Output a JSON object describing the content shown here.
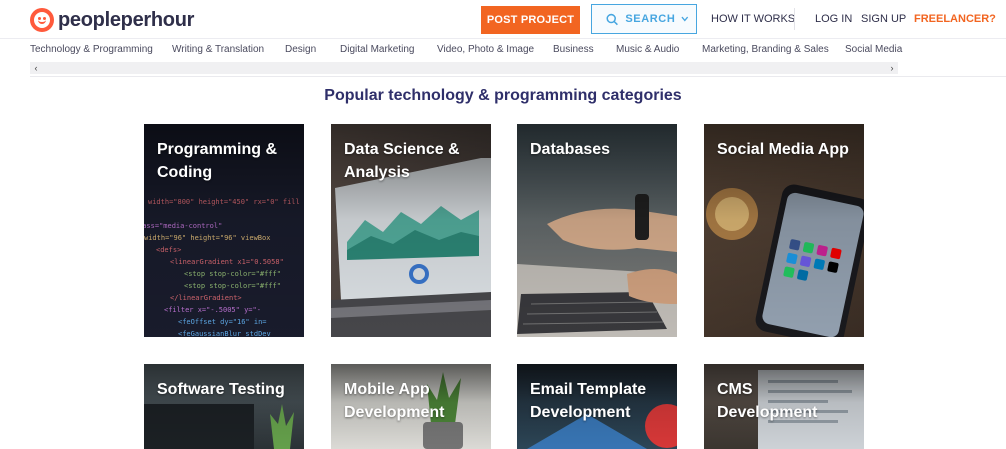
{
  "brand": {
    "name": "peopleperhour"
  },
  "header": {
    "post_project": "POST PROJECT",
    "search_label": "SEARCH",
    "how_it_works": "HOW IT WORKS",
    "log_in": "LOG IN",
    "sign_up": "SIGN UP",
    "freelancer": "FREELANCER?"
  },
  "categories": [
    "Technology & Programming",
    "Writing & Translation",
    "Design",
    "Digital Marketing",
    "Video, Photo & Image",
    "Business",
    "Music & Audio",
    "Marketing, Branding & Sales",
    "Social Media"
  ],
  "scroll": {
    "left": "‹",
    "right": "›"
  },
  "main": {
    "title": "Popular technology & programming categories",
    "cards": [
      {
        "title": "Programming & Coding"
      },
      {
        "title": "Data Science & Analysis"
      },
      {
        "title": "Databases"
      },
      {
        "title": "Social Media App"
      },
      {
        "title": "Software Testing"
      },
      {
        "title": "Mobile App Development"
      },
      {
        "title": "Email Template Development"
      },
      {
        "title": "CMS Development"
      }
    ]
  },
  "colors": {
    "accent": "#f26521",
    "search": "#47a6e0",
    "title": "#2f2f6a",
    "logo": "#ff5a3c"
  }
}
